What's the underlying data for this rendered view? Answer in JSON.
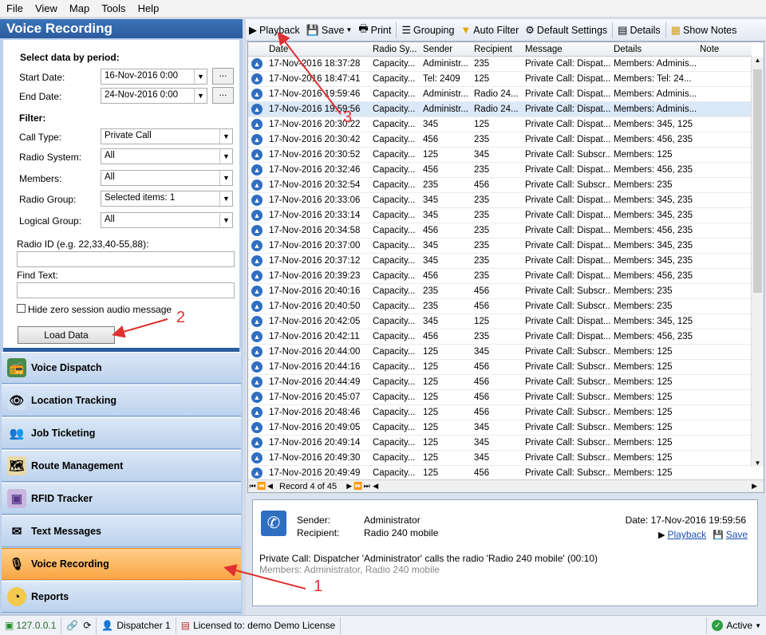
{
  "menu": [
    "File",
    "View",
    "Map",
    "Tools",
    "Help"
  ],
  "left": {
    "title": "Voice Recording",
    "period_label": "Select data by period:",
    "start_label": "Start Date:",
    "start_value": "16-Nov-2016 0:00",
    "end_label": "End Date:",
    "end_value": "24-Nov-2016 0:00",
    "filter_label": "Filter:",
    "call_type_label": "Call Type:",
    "call_type_value": "Private Call",
    "radio_system_label": "Radio System:",
    "radio_system_value": "All",
    "members_label": "Members:",
    "members_value": "All",
    "radio_group_label": "Radio Group:",
    "radio_group_value": "Selected items: 1",
    "logical_group_label": "Logical Group:",
    "logical_group_value": "All",
    "radio_id_label": "Radio ID (e.g. 22,33,40-55,88):",
    "radio_id_value": "",
    "find_text_label": "Find Text:",
    "find_text_value": "",
    "hide_zero_label": "Hide zero session audio message",
    "load_data_label": "Load Data",
    "ellipsis": "..."
  },
  "nav": [
    {
      "label": "Voice Dispatch",
      "icon": "radio-icon"
    },
    {
      "label": "Location Tracking",
      "icon": "eye-icon"
    },
    {
      "label": "Job Ticketing",
      "icon": "people-icon"
    },
    {
      "label": "Route Management",
      "icon": "map-icon"
    },
    {
      "label": "RFID Tracker",
      "icon": "rfid-icon"
    },
    {
      "label": "Text Messages",
      "icon": "envelope-icon"
    },
    {
      "label": "Voice Recording",
      "icon": "microphone-icon"
    },
    {
      "label": "Reports",
      "icon": "chart-icon"
    }
  ],
  "toolbar": {
    "playback": "Playback",
    "save": "Save",
    "print": "Print",
    "grouping": "Grouping",
    "auto_filter": "Auto Filter",
    "default_settings": "Default Settings",
    "details": "Details",
    "show_notes": "Show Notes"
  },
  "grid": {
    "columns": [
      "Date",
      "Radio Sy...",
      "Sender",
      "Recipient",
      "Message",
      "Details",
      "Note"
    ],
    "rows": [
      [
        "17-Nov-2016 18:37:28",
        "Capacity...",
        "Administr...",
        "235",
        "Private Call: Dispat...",
        "Members: Adminis..."
      ],
      [
        "17-Nov-2016 18:47:41",
        "Capacity...",
        "Tel: 2409",
        "125",
        "Private Call: Dispat...",
        "Members: Tel: 24..."
      ],
      [
        "17-Nov-2016 19:59:46",
        "Capacity...",
        "Administr...",
        "Radio 24...",
        "Private Call: Dispat...",
        "Members: Adminis..."
      ],
      [
        "17-Nov-2016 19:59:56",
        "Capacity...",
        "Administr...",
        "Radio 24...",
        "Private Call: Dispat...",
        "Members: Adminis..."
      ],
      [
        "17-Nov-2016 20:30:22",
        "Capacity...",
        "345",
        "125",
        "Private Call: Dispat...",
        "Members: 345, 125"
      ],
      [
        "17-Nov-2016 20:30:42",
        "Capacity...",
        "456",
        "235",
        "Private Call: Dispat...",
        "Members: 456, 235"
      ],
      [
        "17-Nov-2016 20:30:52",
        "Capacity...",
        "125",
        "345",
        "Private Call: Subscr...",
        "Members: 125"
      ],
      [
        "17-Nov-2016 20:32:46",
        "Capacity...",
        "456",
        "235",
        "Private Call: Dispat...",
        "Members: 456, 235"
      ],
      [
        "17-Nov-2016 20:32:54",
        "Capacity...",
        "235",
        "456",
        "Private Call: Subscr...",
        "Members: 235"
      ],
      [
        "17-Nov-2016 20:33:06",
        "Capacity...",
        "345",
        "235",
        "Private Call: Dispat...",
        "Members: 345, 235"
      ],
      [
        "17-Nov-2016 20:33:14",
        "Capacity...",
        "345",
        "235",
        "Private Call: Dispat...",
        "Members: 345, 235"
      ],
      [
        "17-Nov-2016 20:34:58",
        "Capacity...",
        "456",
        "235",
        "Private Call: Dispat...",
        "Members: 456, 235"
      ],
      [
        "17-Nov-2016 20:37:00",
        "Capacity...",
        "345",
        "235",
        "Private Call: Dispat...",
        "Members: 345, 235"
      ],
      [
        "17-Nov-2016 20:37:12",
        "Capacity...",
        "345",
        "235",
        "Private Call: Dispat...",
        "Members: 345, 235"
      ],
      [
        "17-Nov-2016 20:39:23",
        "Capacity...",
        "456",
        "235",
        "Private Call: Dispat...",
        "Members: 456, 235"
      ],
      [
        "17-Nov-2016 20:40:16",
        "Capacity...",
        "235",
        "456",
        "Private Call: Subscr...",
        "Members: 235"
      ],
      [
        "17-Nov-2016 20:40:50",
        "Capacity...",
        "235",
        "456",
        "Private Call: Subscr...",
        "Members: 235"
      ],
      [
        "17-Nov-2016 20:42:05",
        "Capacity...",
        "345",
        "125",
        "Private Call: Dispat...",
        "Members: 345, 125"
      ],
      [
        "17-Nov-2016 20:42:11",
        "Capacity...",
        "456",
        "235",
        "Private Call: Dispat...",
        "Members: 456, 235"
      ],
      [
        "17-Nov-2016 20:44:00",
        "Capacity...",
        "125",
        "345",
        "Private Call: Subscr...",
        "Members: 125"
      ],
      [
        "17-Nov-2016 20:44:16",
        "Capacity...",
        "125",
        "456",
        "Private Call: Subscr...",
        "Members: 125"
      ],
      [
        "17-Nov-2016 20:44:49",
        "Capacity...",
        "125",
        "456",
        "Private Call: Subscr...",
        "Members: 125"
      ],
      [
        "17-Nov-2016 20:45:07",
        "Capacity...",
        "125",
        "456",
        "Private Call: Subscr...",
        "Members: 125"
      ],
      [
        "17-Nov-2016 20:48:46",
        "Capacity...",
        "125",
        "456",
        "Private Call: Subscr...",
        "Members: 125"
      ],
      [
        "17-Nov-2016 20:49:05",
        "Capacity...",
        "125",
        "345",
        "Private Call: Subscr...",
        "Members: 125"
      ],
      [
        "17-Nov-2016 20:49:14",
        "Capacity...",
        "125",
        "345",
        "Private Call: Subscr...",
        "Members: 125"
      ],
      [
        "17-Nov-2016 20:49:30",
        "Capacity...",
        "125",
        "345",
        "Private Call: Subscr...",
        "Members: 125"
      ],
      [
        "17-Nov-2016 20:49:49",
        "Capacity...",
        "125",
        "456",
        "Private Call: Subscr...",
        "Members: 125"
      ]
    ],
    "selected_row": 3,
    "record_text": "Record 4 of 45"
  },
  "detail": {
    "sender_label": "Sender:",
    "sender_value": "Administrator",
    "recipient_label": "Recipient:",
    "recipient_value": "Radio 240 mobile",
    "date_text": "Date: 17-Nov-2016 19:59:56",
    "playback": "Playback",
    "save": "Save",
    "message": "Private Call: Dispatcher 'Administrator' calls the radio 'Radio 240 mobile' (00:10)",
    "members": "Members: Administrator, Radio 240 mobile"
  },
  "status": {
    "ip": "127.0.0.1",
    "user": "Dispatcher 1",
    "license": "Licensed to: demo Demo License",
    "state": "Active"
  },
  "annotations": [
    "1",
    "2",
    "3"
  ],
  "colors": {
    "header_blue": "#2b5c9e",
    "active_nav": "#f8a542",
    "arrow": "#e03030"
  }
}
